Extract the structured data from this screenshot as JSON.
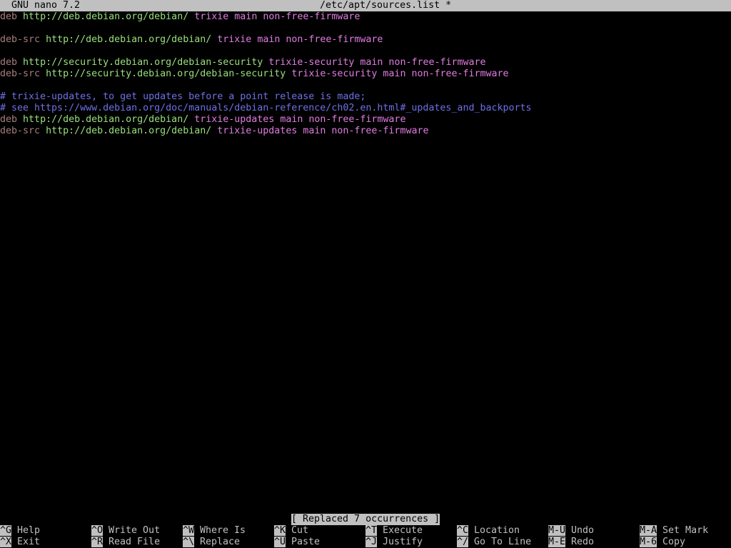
{
  "titlebar": {
    "app": "GNU nano 7.2",
    "file": "/etc/apt/sources.list *"
  },
  "lines": [
    {
      "type": "deb",
      "kw": "deb",
      "url": "http://deb.debian.org/debian/",
      "suite": "trixie",
      "components": "main non-free-firmware"
    },
    {
      "type": "blank"
    },
    {
      "type": "deb",
      "kw": "deb-src",
      "url": "http://deb.debian.org/debian/",
      "suite": "trixie",
      "components": "main non-free-firmware"
    },
    {
      "type": "blank"
    },
    {
      "type": "deb",
      "kw": "deb",
      "url": "http://security.debian.org/debian-security",
      "suite": "trixie-security",
      "components": "main non-free-firmware"
    },
    {
      "type": "deb",
      "kw": "deb-src",
      "url": "http://security.debian.org/debian-security",
      "suite": "trixie-security",
      "components": "main non-free-firmware"
    },
    {
      "type": "blank"
    },
    {
      "type": "comment",
      "text": "# trixie-updates, to get updates before a point release is made;"
    },
    {
      "type": "comment",
      "text": "# see https://www.debian.org/doc/manuals/debian-reference/ch02.en.html#_updates_and_backports"
    },
    {
      "type": "deb",
      "kw": "deb",
      "url": "http://deb.debian.org/debian/",
      "suite": "trixie-updates",
      "components": "main non-free-firmware"
    },
    {
      "type": "deb",
      "kw": "deb-src",
      "url": "http://deb.debian.org/debian/",
      "suite": "trixie-updates",
      "components": "main non-free-firmware"
    }
  ],
  "status_message": "[ Replaced 7 occurrences ]",
  "shortcuts": [
    {
      "key": "^G",
      "label": "Help"
    },
    {
      "key": "^X",
      "label": "Exit"
    },
    {
      "key": "^O",
      "label": "Write Out"
    },
    {
      "key": "^R",
      "label": "Read File"
    },
    {
      "key": "^W",
      "label": "Where Is"
    },
    {
      "key": "^\\",
      "label": "Replace"
    },
    {
      "key": "^K",
      "label": "Cut"
    },
    {
      "key": "^U",
      "label": "Paste"
    },
    {
      "key": "^T",
      "label": "Execute"
    },
    {
      "key": "^J",
      "label": "Justify"
    },
    {
      "key": "^C",
      "label": "Location"
    },
    {
      "key": "^/",
      "label": "Go To Line"
    },
    {
      "key": "M-U",
      "label": "Undo"
    },
    {
      "key": "M-E",
      "label": "Redo"
    },
    {
      "key": "M-A",
      "label": "Set Mark"
    },
    {
      "key": "M-6",
      "label": "Copy"
    }
  ],
  "colors": {
    "keyword": "#a87e7e",
    "url": "#98e07c",
    "suite": "#e07ce0",
    "comment": "#6f6fe8",
    "bar_bg": "#c0c0c0"
  }
}
